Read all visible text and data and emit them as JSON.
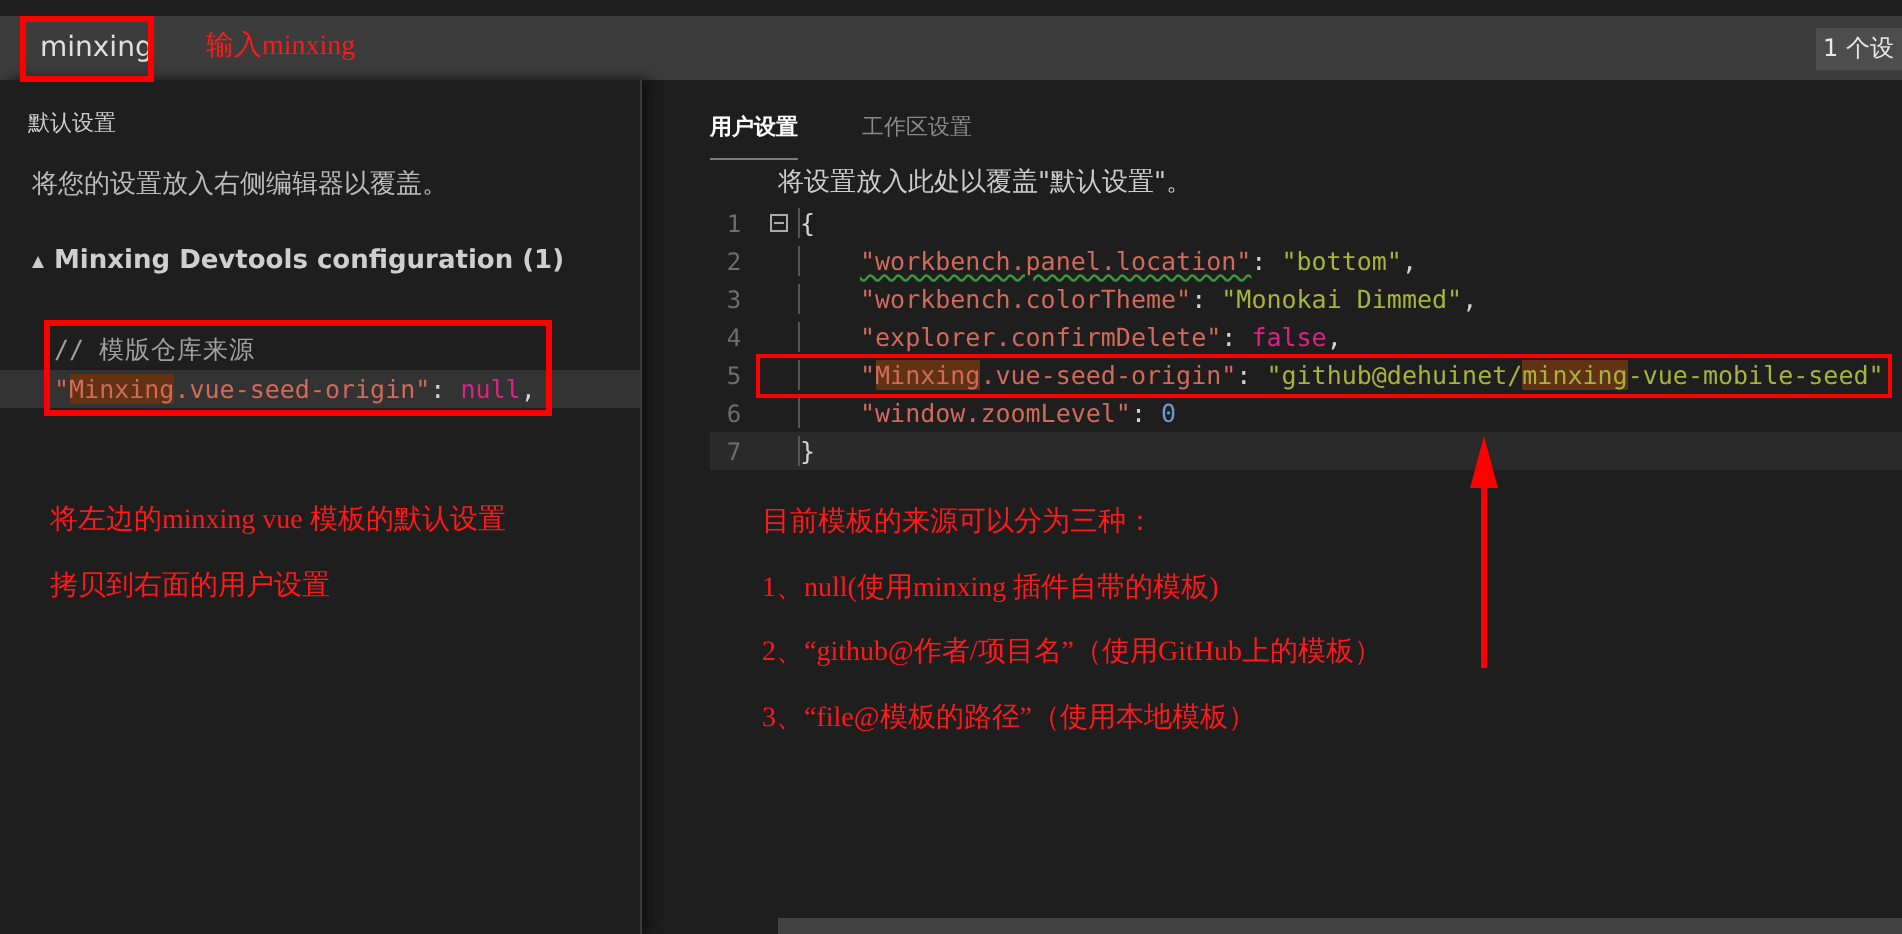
{
  "search": {
    "value": "minxing",
    "count": "1 个设"
  },
  "default_settings": {
    "title": "默认设置",
    "hint": "将您的设置放入右侧编辑器以覆盖。",
    "group": {
      "title": "Minxing Devtools configuration (1)",
      "expanded": true,
      "lines": [
        {
          "current": false,
          "tokens": [
            {
              "kind": "comment",
              "text": "// 模版仓库来源"
            }
          ]
        },
        {
          "current": true,
          "tokens": [
            {
              "kind": "key",
              "text": "\""
            },
            {
              "kind": "key",
              "text": "Minxing",
              "match": true
            },
            {
              "kind": "key",
              "text": ".vue-seed-origin\""
            },
            {
              "kind": "punct",
              "text": ": "
            },
            {
              "kind": "keyword",
              "text": "null"
            },
            {
              "kind": "punct",
              "text": ","
            }
          ]
        }
      ]
    }
  },
  "user_settings": {
    "tabs": [
      {
        "label": "用户设置",
        "selected": true
      },
      {
        "label": "工作区设置",
        "selected": false
      }
    ],
    "hint": "将设置放入此处以覆盖\"默认设置\"。",
    "lines": [
      {
        "number": "1",
        "kind": "brace",
        "fold": true,
        "current": false,
        "tokens": [
          {
            "kind": "punct",
            "text": "{"
          }
        ]
      },
      {
        "number": "2",
        "kind": "member",
        "fold": false,
        "current": false,
        "tokens": [
          {
            "kind": "key",
            "text": "\"workbench.panel.location\"",
            "warning": true
          },
          {
            "kind": "punct",
            "text": ": "
          },
          {
            "kind": "string",
            "text": "\"bottom\""
          },
          {
            "kind": "punct",
            "text": ","
          }
        ]
      },
      {
        "number": "3",
        "kind": "member",
        "fold": false,
        "current": false,
        "tokens": [
          {
            "kind": "key",
            "text": "\"workbench.colorTheme\""
          },
          {
            "kind": "punct",
            "text": ": "
          },
          {
            "kind": "string",
            "text": "\"Monokai Dimmed\""
          },
          {
            "kind": "punct",
            "text": ","
          }
        ]
      },
      {
        "number": "4",
        "kind": "member",
        "fold": false,
        "current": false,
        "tokens": [
          {
            "kind": "key",
            "text": "\"explorer.confirmDelete\""
          },
          {
            "kind": "punct",
            "text": ": "
          },
          {
            "kind": "keyword",
            "text": "false"
          },
          {
            "kind": "punct",
            "text": ","
          }
        ]
      },
      {
        "number": "5",
        "kind": "member",
        "fold": false,
        "current": false,
        "tokens": [
          {
            "kind": "key",
            "text": "\""
          },
          {
            "kind": "key",
            "text": "Minxing",
            "match": true
          },
          {
            "kind": "key",
            "text": ".vue-seed-origin\""
          },
          {
            "kind": "punct",
            "text": ": "
          },
          {
            "kind": "string",
            "text": "\"github@dehuinet/"
          },
          {
            "kind": "string",
            "text": "minxing",
            "match": true
          },
          {
            "kind": "string",
            "text": "-vue-mobile-seed\""
          }
        ]
      },
      {
        "number": "6",
        "kind": "member",
        "fold": false,
        "current": false,
        "tokens": [
          {
            "kind": "key",
            "text": "\"window.zoomLevel\""
          },
          {
            "kind": "punct",
            "text": ": "
          },
          {
            "kind": "number",
            "text": "0"
          }
        ]
      },
      {
        "number": "7",
        "kind": "brace",
        "fold": false,
        "current": true,
        "tokens": [
          {
            "kind": "punct",
            "text": "}"
          }
        ]
      }
    ]
  },
  "annotations": {
    "search_note": "输入minxing",
    "left_notes": [
      "将左边的minxing vue 模板的默认设置",
      "拷贝到右面的用户设置"
    ],
    "right_notes": [
      "目前模板的来源可以分为三种：",
      "1、null(使用minxing 插件自带的模板)",
      "2、“github@作者/项目名”（使用GitHub上的模板）",
      "3、“file@模板的路径”（使用本地模板）"
    ]
  }
}
